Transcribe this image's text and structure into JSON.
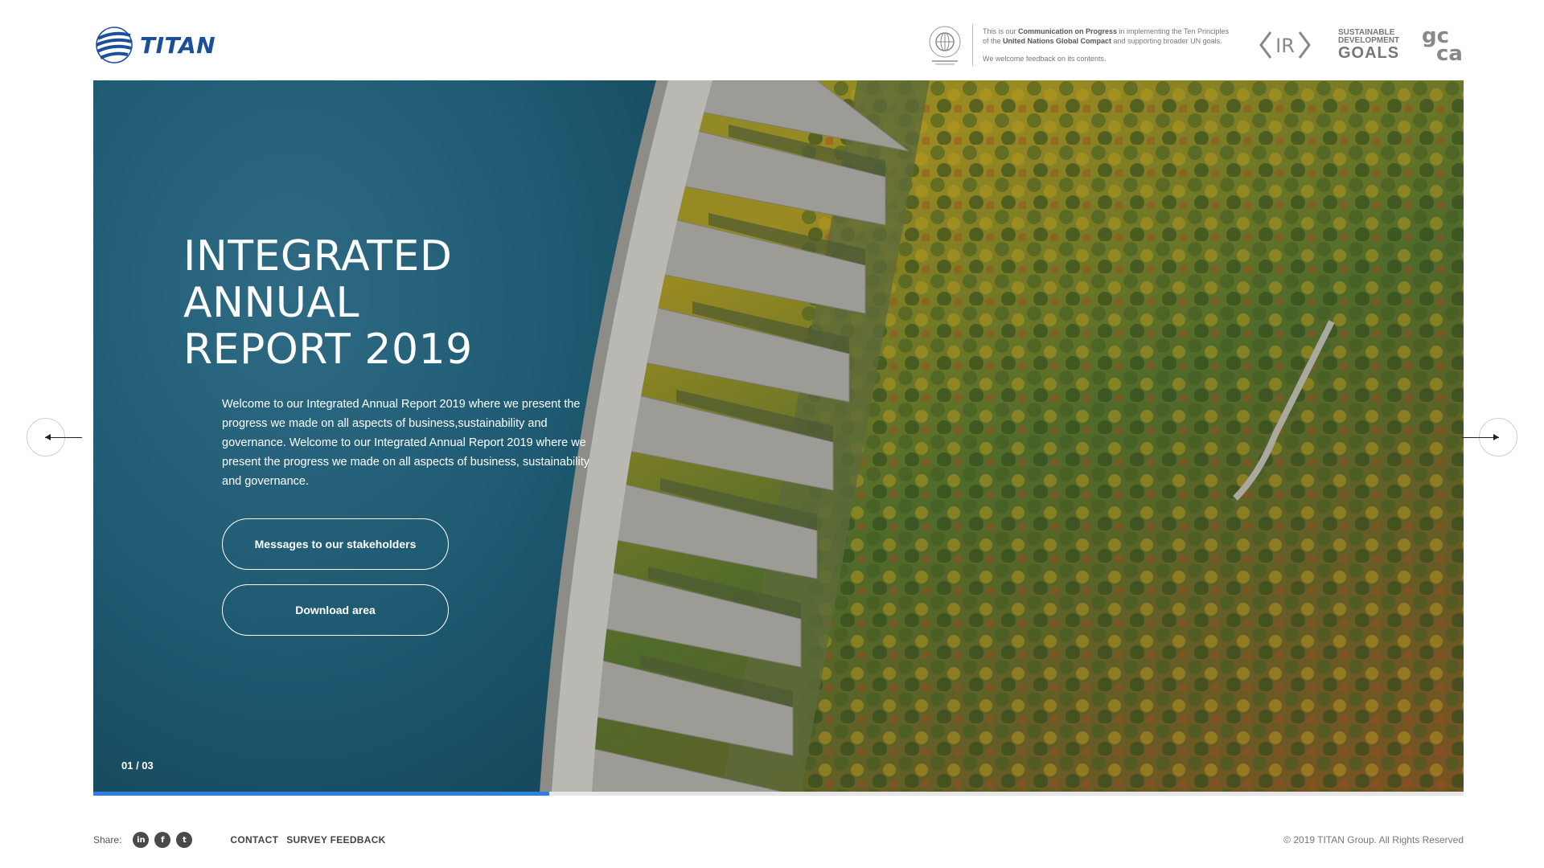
{
  "header": {
    "logo_text": "TITAN",
    "ungc": {
      "line1_pre": "This is our ",
      "line1_bold": "Communication on Progress",
      "line1_post": " in implementing the Ten Principles",
      "line2_pre": "of the ",
      "line2_bold": "United Nations Global Compact",
      "line2_post": " and supporting broader UN goals.",
      "feedback": "We welcome feedback on its contents."
    },
    "ir_label": "IR",
    "sdg": {
      "line1": "SUSTAINABLE",
      "line2": "DEVELOPMENT",
      "line3": "GOALS"
    },
    "gcca": {
      "l1": "gc",
      "l2": "ca"
    }
  },
  "hero": {
    "title_lines": [
      "INTEGRATED",
      "ANNUAL",
      "REPORT 2019"
    ],
    "description": "Welcome to our Integrated Annual Report 2019 where we present the progress we made on all aspects of business,sustainability and governance. Welcome to our Integrated Annual Report 2019 where we present the progress we made on all aspects of business, sustainability and governance.",
    "cta_primary": "Messages to our stakeholders",
    "cta_secondary": "Download area",
    "counter": "01 / 03",
    "progress_fraction": 0.333
  },
  "footer": {
    "share_label": "Share:",
    "social": [
      {
        "name": "linkedin",
        "glyph": "in"
      },
      {
        "name": "facebook",
        "glyph": "f"
      },
      {
        "name": "twitter",
        "glyph": "t"
      }
    ],
    "links": [
      "CONTACT",
      "SURVEY FEEDBACK"
    ],
    "copyright": "© 2019 TITAN Group. All Rights Reserved"
  },
  "colors": {
    "brand_blue": "#1b4f9b",
    "progress": "#2f7fe0",
    "water": "#1e5a72"
  }
}
